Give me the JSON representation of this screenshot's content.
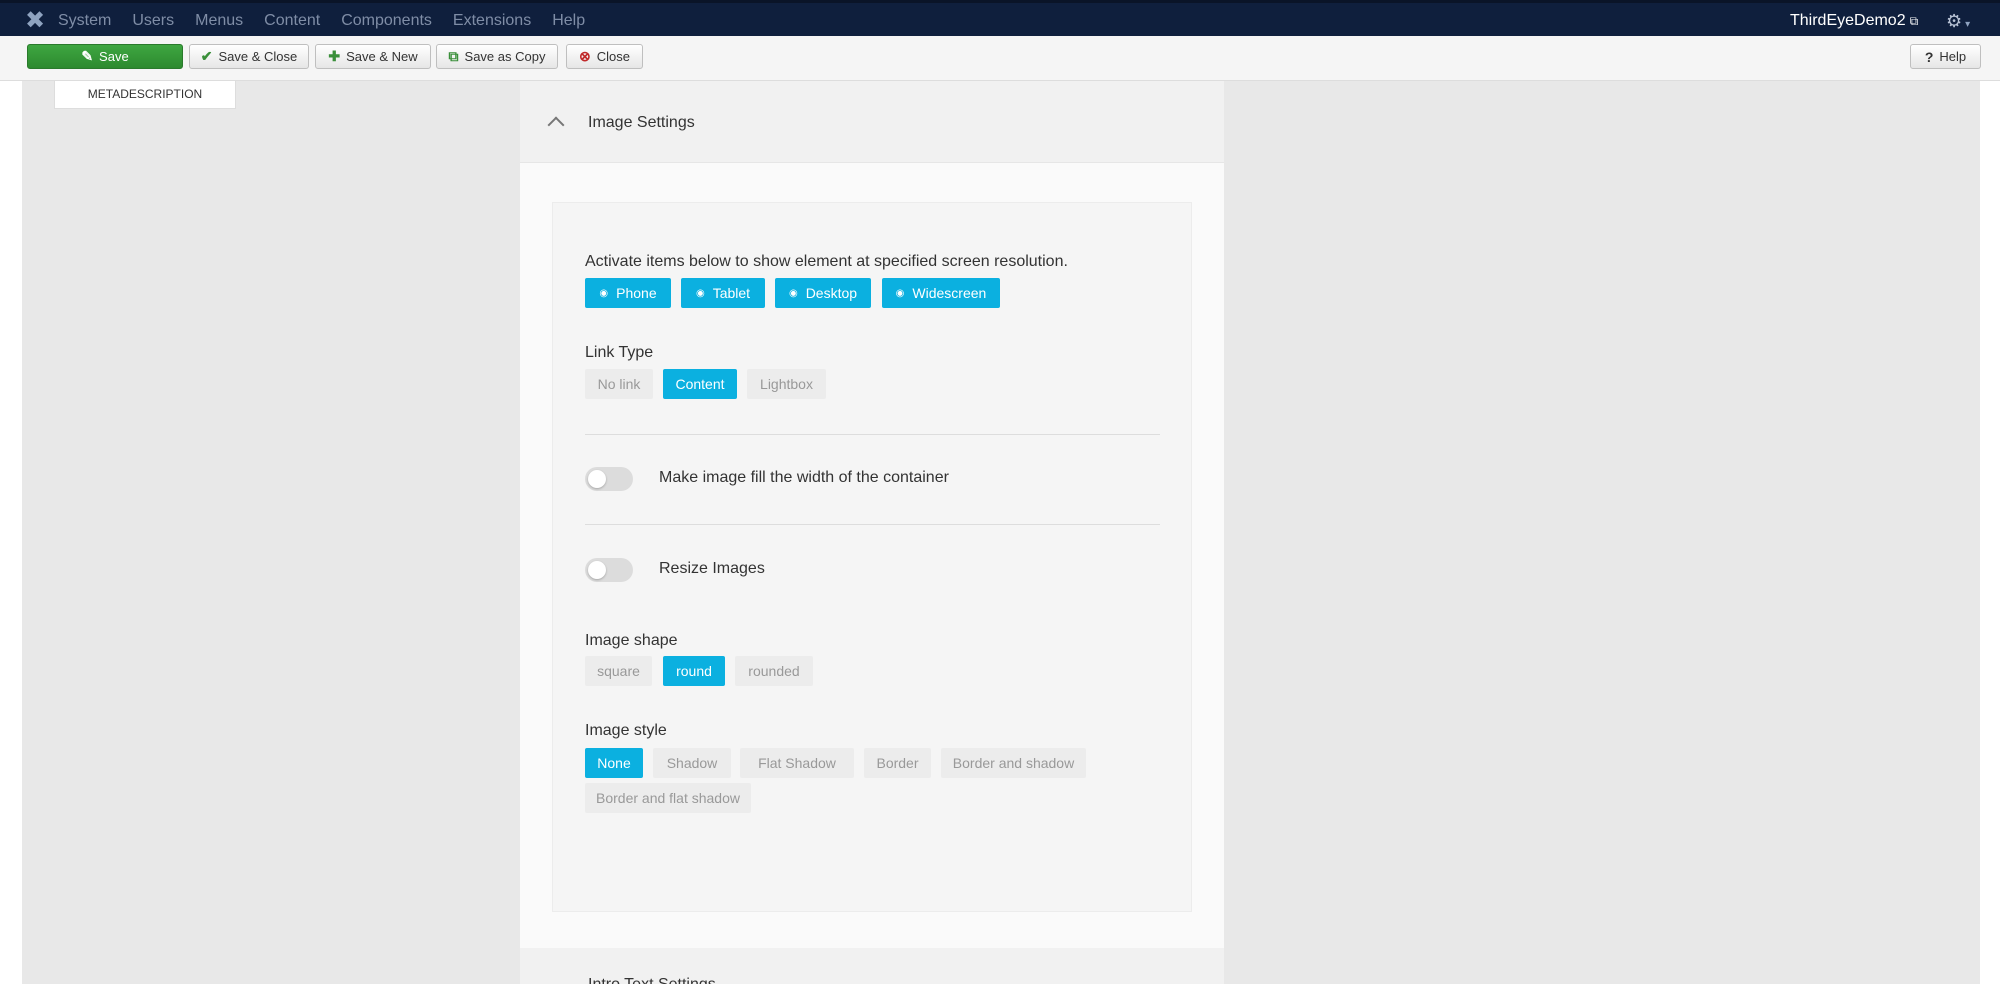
{
  "navbar": {
    "menu": [
      "System",
      "Users",
      "Menus",
      "Content",
      "Components",
      "Extensions",
      "Help"
    ],
    "site_name": "ThirdEyeDemo2",
    "icons": {
      "logo": "joomla-logo-icon",
      "external": "external-link-icon",
      "settings": "gear-icon"
    }
  },
  "toolbar": {
    "save": "Save",
    "save_close": "Save & Close",
    "save_new": "Save & New",
    "save_copy": "Save as Copy",
    "close": "Close",
    "help": "Help"
  },
  "sidebar": {
    "tab_label": "METADESCRIPTION"
  },
  "panel": {
    "title": "Image Settings",
    "responsive": {
      "label": "Activate items below to show element at specified screen resolution.",
      "devices": [
        "Phone",
        "Tablet",
        "Desktop",
        "Widescreen"
      ]
    },
    "link_type": {
      "label": "Link Type",
      "options": [
        "No link",
        "Content",
        "Lightbox"
      ],
      "selected": "Content"
    },
    "fill_width": {
      "label": "Make image fill the width of the container",
      "enabled": false
    },
    "resize": {
      "label": "Resize Images",
      "enabled": false
    },
    "image_shape": {
      "label": "Image shape",
      "options": [
        "square",
        "round",
        "rounded"
      ],
      "selected": "round"
    },
    "image_style": {
      "label": "Image style",
      "options": [
        "None",
        "Shadow",
        "Flat Shadow",
        "Border",
        "Border and shadow",
        "Border and flat shadow"
      ],
      "selected": "None"
    },
    "next_section": "Intro Text Settings"
  },
  "colors": {
    "navbar": "#0f1f3d",
    "accent": "#0bb0e0",
    "save": "#3ea641"
  }
}
